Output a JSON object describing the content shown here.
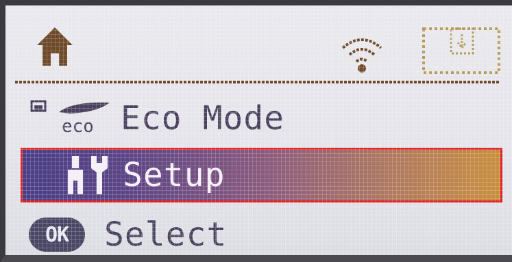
{
  "status_bar": {
    "icons": [
      "home-icon",
      "wifi-icon",
      "ink-cartridge-icon"
    ]
  },
  "menu": {
    "items": [
      {
        "label": "Eco Mode",
        "icon": "eco-leaf-icon",
        "icon_text": "eco",
        "selected": false
      },
      {
        "label": "Setup",
        "icon": "wrench-icon",
        "selected": true
      }
    ]
  },
  "footer": {
    "button": "OK",
    "action": "Select"
  },
  "colors": {
    "lcd_background": "#e6e6ec",
    "text": "#48405c",
    "icon_brown": "#6f4a2a",
    "selection_start": "#4a3e86",
    "selection_end": "#c98e3e",
    "selection_outline": "#e32323"
  }
}
